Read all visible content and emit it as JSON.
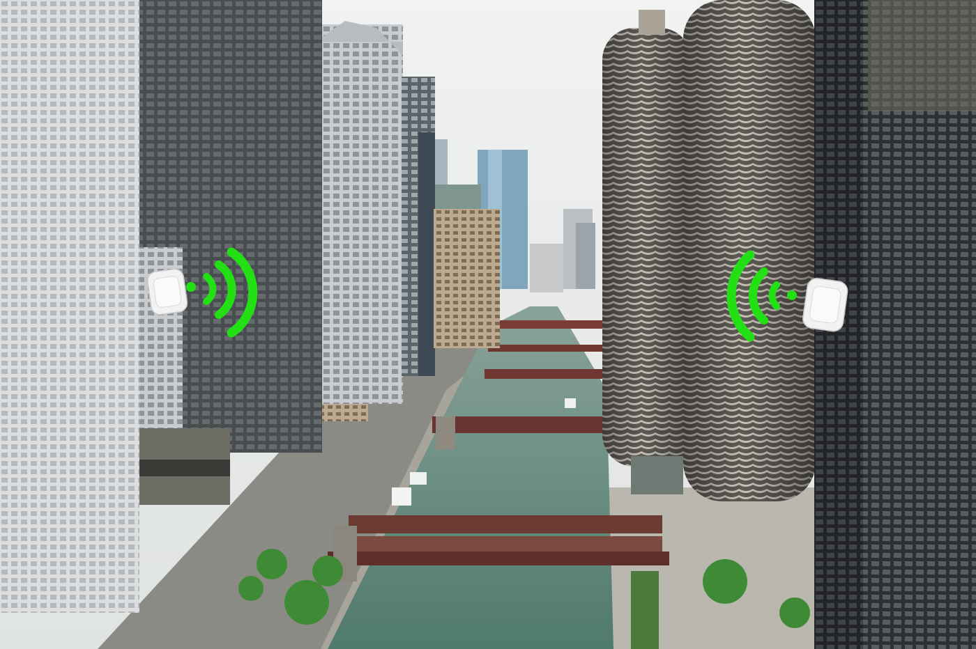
{
  "scene": {
    "description_icon_left": "wireless-access-point-icon",
    "description_icon_right": "wireless-access-point-icon",
    "signal_icon": "wifi-signal-icon"
  },
  "colors": {
    "sky": "#eef0f0",
    "signal_green": "#22e014",
    "river": "#5f8478",
    "building_dark": "#2b2d30",
    "building_light": "#cfd2d4",
    "marina_tower": "#9a9488",
    "bridge": "#6a3a34",
    "device": "#eeeeee"
  }
}
